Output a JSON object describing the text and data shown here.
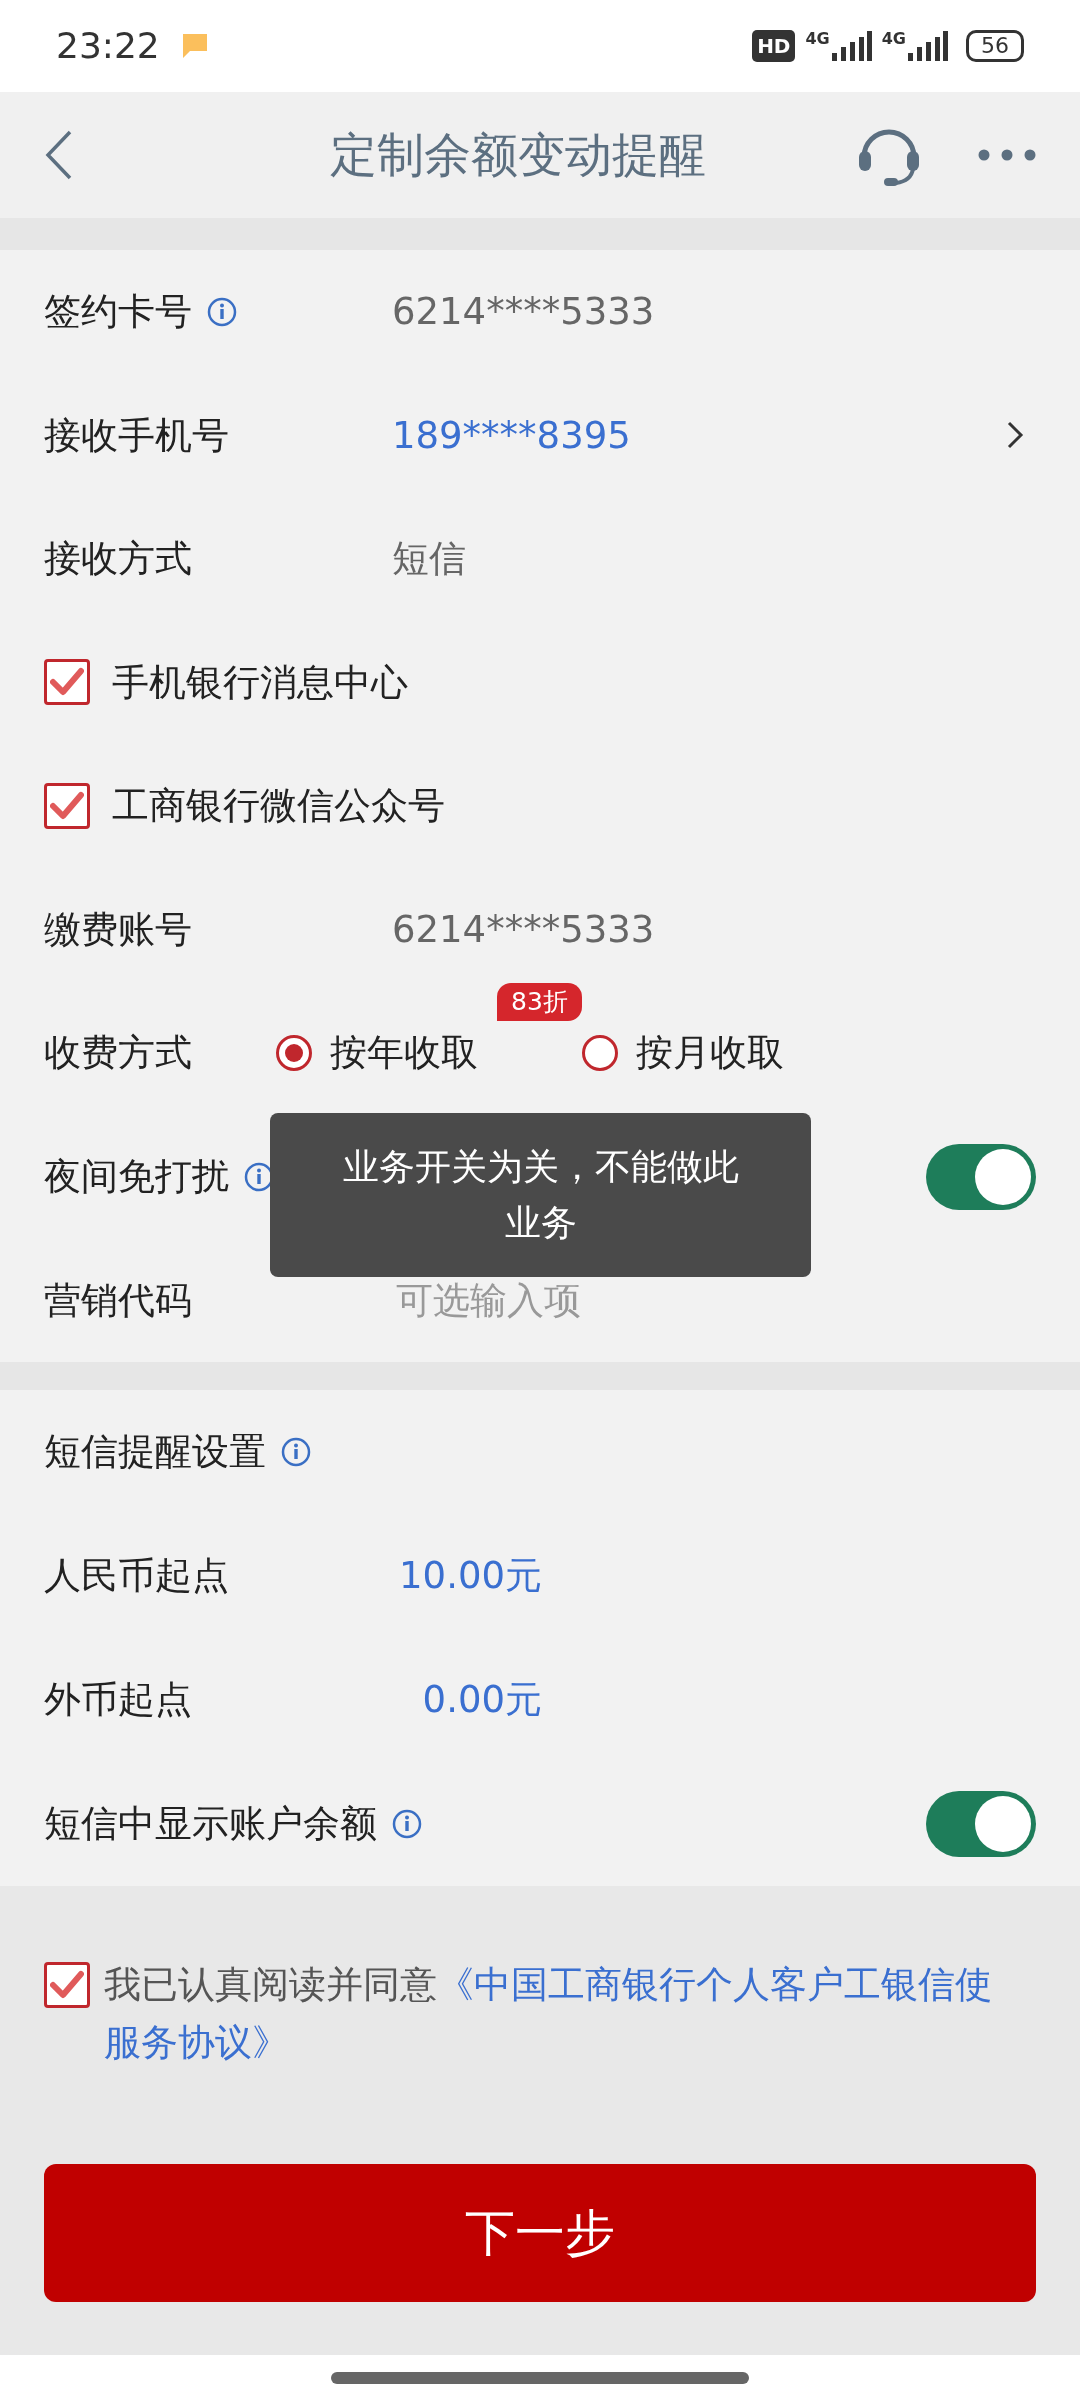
{
  "status_bar": {
    "time": "23:22",
    "hd_badge": "HD",
    "networks": [
      "4G",
      "4G"
    ],
    "battery": "56"
  },
  "header": {
    "title": "定制余额变动提醒"
  },
  "settings": [
    {
      "kind": "text",
      "label": "签约卡号",
      "info": true,
      "value": "6214****5333"
    },
    {
      "kind": "link",
      "label": "接收手机号",
      "info": false,
      "value": "189****8395"
    },
    {
      "kind": "text",
      "label": "接收方式",
      "info": false,
      "value": "短信"
    },
    {
      "kind": "checkbox",
      "label": "手机银行消息中心",
      "info": false,
      "checked": true
    },
    {
      "kind": "checkbox",
      "label": "工商银行微信公众号",
      "info": false,
      "checked": true
    },
    {
      "kind": "text",
      "label": "缴费账号",
      "info": false,
      "value": "6214****5333"
    },
    {
      "kind": "radio",
      "label": "收费方式",
      "info": false,
      "options": [
        {
          "label": "按年收取",
          "selected": true,
          "badge": "83折"
        },
        {
          "label": "按月收取",
          "selected": false
        }
      ]
    },
    {
      "kind": "toggle",
      "label": "夜间免打扰",
      "info": true,
      "on": true
    },
    {
      "kind": "input",
      "label": "营销代码",
      "info": false,
      "placeholder": "可选输入项"
    }
  ],
  "sms_settings": {
    "title": "短信提醒设置",
    "info": true,
    "rows": [
      {
        "kind": "amount",
        "label": "人民币起点",
        "info": false,
        "value": "10.00元"
      },
      {
        "kind": "amount",
        "label": "外币起点",
        "info": false,
        "value": "0.00元"
      },
      {
        "kind": "toggle",
        "label": "短信中显示账户余额",
        "info": true,
        "on": true
      }
    ]
  },
  "agreement": {
    "checked": true,
    "text": "我已认真阅读并同意",
    "link": "《中国工商银行个人客户工银信使服务协议》"
  },
  "primary_button": "下一步",
  "toast": "业务开关为关，不能做此业务"
}
